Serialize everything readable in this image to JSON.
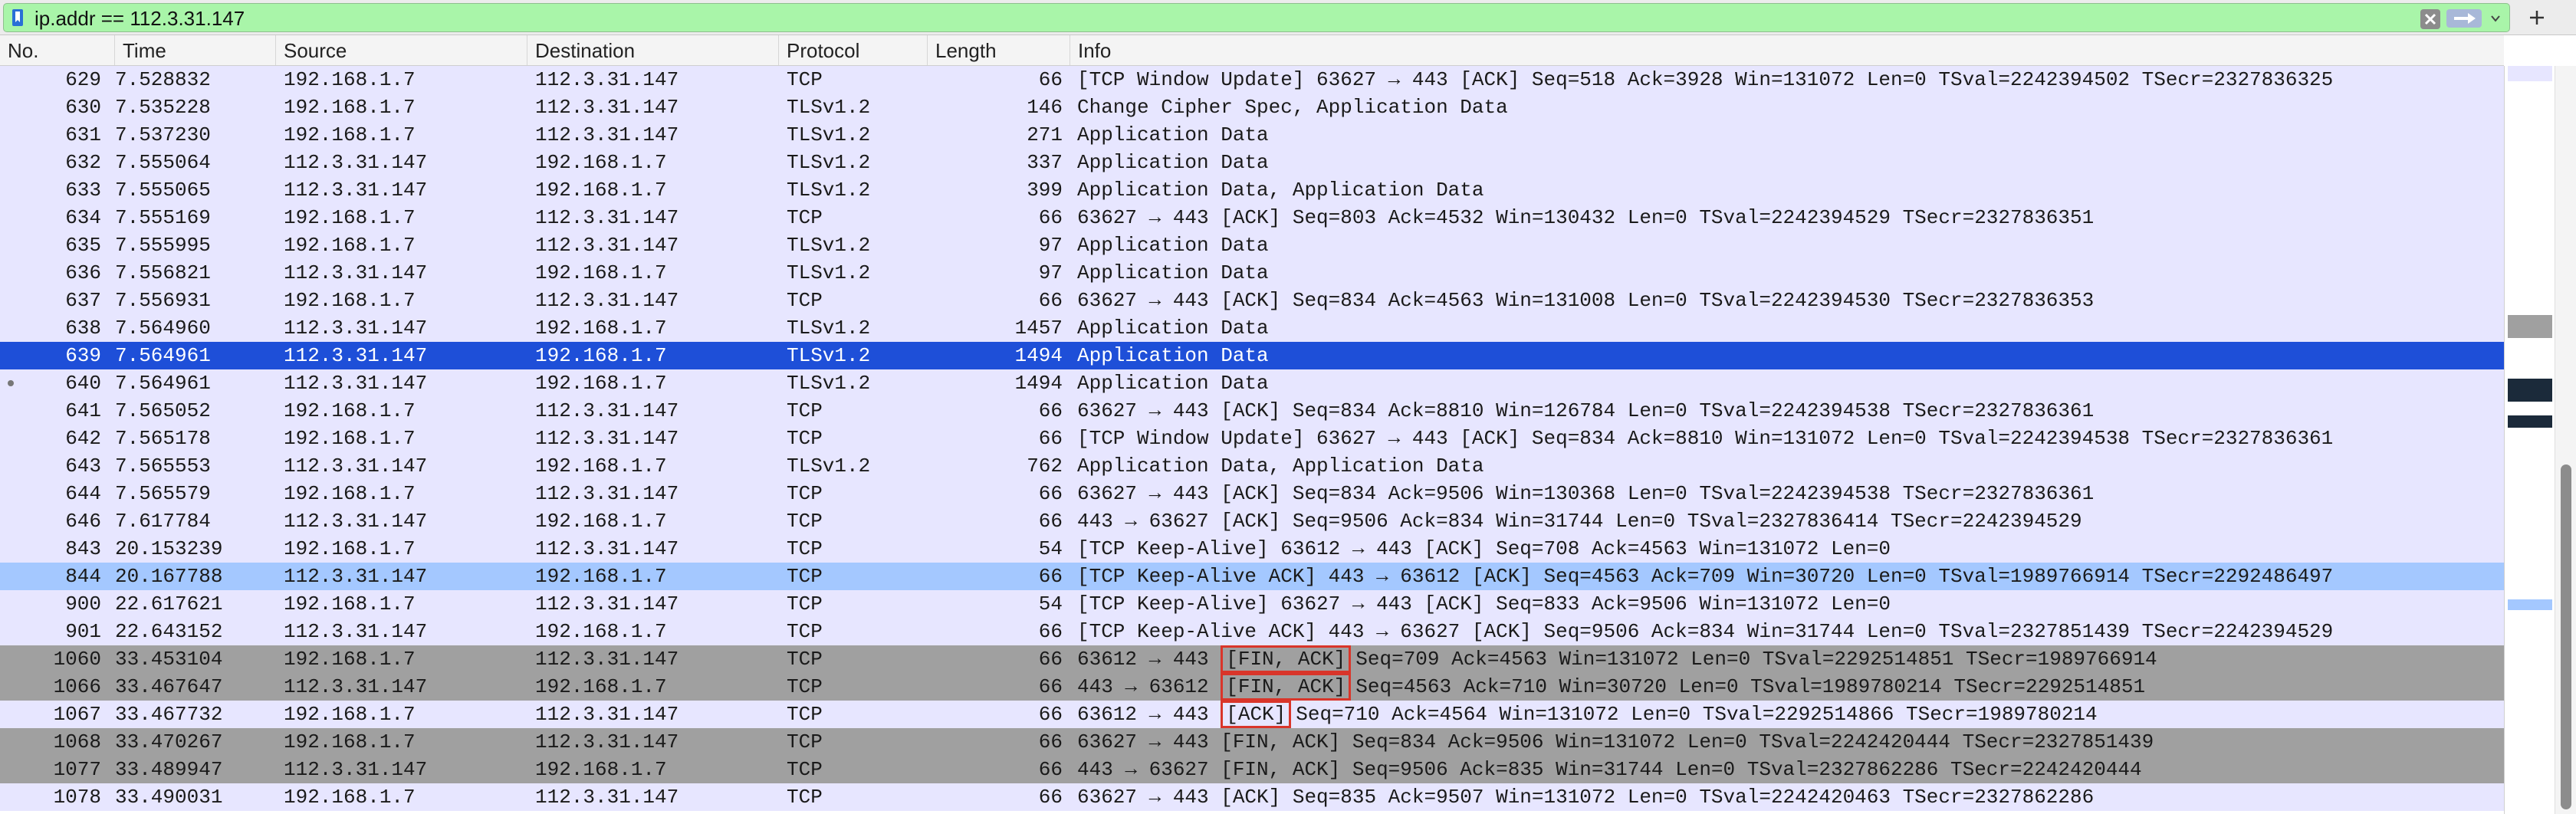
{
  "filter": {
    "value": "ip.addr == 112.3.31.147"
  },
  "columns": {
    "no": "No.",
    "time": "Time",
    "source": "Source",
    "destination": "Destination",
    "protocol": "Protocol",
    "length": "Length",
    "info": "Info"
  },
  "colors": {
    "filter_valid": "#a9f5a9",
    "row_default": "#e7e6ff",
    "row_selected": "#1e4fd8",
    "row_related": "#a4c8ff",
    "row_fin": "#a0a0a0",
    "highlight_box": "#d9352a"
  },
  "icons": {
    "bookmark": "bookmark-icon",
    "clear": "clear-icon",
    "apply": "apply-arrow-icon",
    "dropdown": "chevron-down-icon",
    "add": "plus-icon"
  },
  "packets": [
    {
      "no": "629",
      "time": "7.528832",
      "src": "192.168.1.7",
      "dst": "112.3.31.147",
      "proto": "TCP",
      "len": "66",
      "flag": "",
      "info": "[TCP Window Update] 63627 → 443 [ACK] Seq=518 Ack=3928 Win=131072 Len=0 TSval=2242394502 TSecr=2327836325",
      "style": "default"
    },
    {
      "no": "630",
      "time": "7.535228",
      "src": "192.168.1.7",
      "dst": "112.3.31.147",
      "proto": "TLSv1.2",
      "len": "146",
      "flag": "",
      "info": "Change Cipher Spec, Application Data",
      "style": "default"
    },
    {
      "no": "631",
      "time": "7.537230",
      "src": "192.168.1.7",
      "dst": "112.3.31.147",
      "proto": "TLSv1.2",
      "len": "271",
      "flag": "",
      "info": "Application Data",
      "style": "default"
    },
    {
      "no": "632",
      "time": "7.555064",
      "src": "112.3.31.147",
      "dst": "192.168.1.7",
      "proto": "TLSv1.2",
      "len": "337",
      "flag": "",
      "info": "Application Data",
      "style": "default"
    },
    {
      "no": "633",
      "time": "7.555065",
      "src": "112.3.31.147",
      "dst": "192.168.1.7",
      "proto": "TLSv1.2",
      "len": "399",
      "flag": "",
      "info": "Application Data, Application Data",
      "style": "default"
    },
    {
      "no": "634",
      "time": "7.555169",
      "src": "192.168.1.7",
      "dst": "112.3.31.147",
      "proto": "TCP",
      "len": "66",
      "flag": "",
      "info": "63627 → 443 [ACK] Seq=803 Ack=4532 Win=130432 Len=0 TSval=2242394529 TSecr=2327836351",
      "style": "default"
    },
    {
      "no": "635",
      "time": "7.555995",
      "src": "192.168.1.7",
      "dst": "112.3.31.147",
      "proto": "TLSv1.2",
      "len": "97",
      "flag": "",
      "info": "Application Data",
      "style": "default"
    },
    {
      "no": "636",
      "time": "7.556821",
      "src": "112.3.31.147",
      "dst": "192.168.1.7",
      "proto": "TLSv1.2",
      "len": "97",
      "flag": "",
      "info": "Application Data",
      "style": "default"
    },
    {
      "no": "637",
      "time": "7.556931",
      "src": "192.168.1.7",
      "dst": "112.3.31.147",
      "proto": "TCP",
      "len": "66",
      "flag": "",
      "info": "63627 → 443 [ACK] Seq=834 Ack=4563 Win=131008 Len=0 TSval=2242394530 TSecr=2327836353",
      "style": "default"
    },
    {
      "no": "638",
      "time": "7.564960",
      "src": "112.3.31.147",
      "dst": "192.168.1.7",
      "proto": "TLSv1.2",
      "len": "1457",
      "flag": "",
      "info": "Application Data",
      "style": "default"
    },
    {
      "no": "639",
      "time": "7.564961",
      "src": "112.3.31.147",
      "dst": "192.168.1.7",
      "proto": "TLSv1.2",
      "len": "1494",
      "flag": "",
      "info": "Application Data",
      "style": "selected"
    },
    {
      "no": "640",
      "time": "7.564961",
      "src": "112.3.31.147",
      "dst": "192.168.1.7",
      "proto": "TLSv1.2",
      "len": "1494",
      "flag": "",
      "info": "Application Data",
      "style": "default"
    },
    {
      "no": "641",
      "time": "7.565052",
      "src": "192.168.1.7",
      "dst": "112.3.31.147",
      "proto": "TCP",
      "len": "66",
      "flag": "",
      "info": "63627 → 443 [ACK] Seq=834 Ack=8810 Win=126784 Len=0 TSval=2242394538 TSecr=2327836361",
      "style": "default"
    },
    {
      "no": "642",
      "time": "7.565178",
      "src": "192.168.1.7",
      "dst": "112.3.31.147",
      "proto": "TCP",
      "len": "66",
      "flag": "",
      "info": "[TCP Window Update] 63627 → 443 [ACK] Seq=834 Ack=8810 Win=131072 Len=0 TSval=2242394538 TSecr=2327836361",
      "style": "default"
    },
    {
      "no": "643",
      "time": "7.565553",
      "src": "112.3.31.147",
      "dst": "192.168.1.7",
      "proto": "TLSv1.2",
      "len": "762",
      "flag": "",
      "info": "Application Data, Application Data",
      "style": "default"
    },
    {
      "no": "644",
      "time": "7.565579",
      "src": "192.168.1.7",
      "dst": "112.3.31.147",
      "proto": "TCP",
      "len": "66",
      "flag": "",
      "info": "63627 → 443 [ACK] Seq=834 Ack=9506 Win=130368 Len=0 TSval=2242394538 TSecr=2327836361",
      "style": "default"
    },
    {
      "no": "646",
      "time": "7.617784",
      "src": "112.3.31.147",
      "dst": "192.168.1.7",
      "proto": "TCP",
      "len": "66",
      "flag": "",
      "info": "443 → 63627 [ACK] Seq=9506 Ack=834 Win=31744 Len=0 TSval=2327836414 TSecr=2242394529",
      "style": "default"
    },
    {
      "no": "843",
      "time": "20.153239",
      "src": "192.168.1.7",
      "dst": "112.3.31.147",
      "proto": "TCP",
      "len": "54",
      "flag": "",
      "info": "[TCP Keep-Alive] 63612 → 443 [ACK] Seq=708 Ack=4563 Win=131072 Len=0",
      "style": "default"
    },
    {
      "no": "844",
      "time": "20.167788",
      "src": "112.3.31.147",
      "dst": "192.168.1.7",
      "proto": "TCP",
      "len": "66",
      "flag": "",
      "info": "[TCP Keep-Alive ACK] 443 → 63612 [ACK] Seq=4563 Ack=709 Win=30720 Len=0 TSval=1989766914 TSecr=2292486497",
      "style": "related"
    },
    {
      "no": "900",
      "time": "22.617621",
      "src": "192.168.1.7",
      "dst": "112.3.31.147",
      "proto": "TCP",
      "len": "54",
      "flag": "",
      "info": "[TCP Keep-Alive] 63627 → 443 [ACK] Seq=833 Ack=9506 Win=131072 Len=0",
      "style": "default"
    },
    {
      "no": "901",
      "time": "22.643152",
      "src": "112.3.31.147",
      "dst": "192.168.1.7",
      "proto": "TCP",
      "len": "66",
      "flag": "",
      "info": "[TCP Keep-Alive ACK] 443 → 63627 [ACK] Seq=9506 Ack=834 Win=31744 Len=0 TSval=2327851439 TSecr=2242394529",
      "style": "default"
    },
    {
      "no": "1060",
      "time": "33.453104",
      "src": "192.168.1.7",
      "dst": "112.3.31.147",
      "proto": "TCP",
      "len": "66",
      "prefix": "63612 → 443",
      "flag": "[FIN, ACK]",
      "info": "Seq=709 Ack=4563 Win=131072 Len=0 TSval=2292514851 TSecr=1989766914",
      "style": "fin"
    },
    {
      "no": "1066",
      "time": "33.467647",
      "src": "112.3.31.147",
      "dst": "192.168.1.7",
      "proto": "TCP",
      "len": "66",
      "prefix": "443 → 63612",
      "flag": "[FIN, ACK]",
      "info": "Seq=4563 Ack=710 Win=30720 Len=0 TSval=1989780214 TSecr=2292514851",
      "style": "fin"
    },
    {
      "no": "1067",
      "time": "33.467732",
      "src": "192.168.1.7",
      "dst": "112.3.31.147",
      "proto": "TCP",
      "len": "66",
      "prefix": "63612 → 443",
      "flag": "[ACK]",
      "info": "Seq=710 Ack=4564 Win=131072 Len=0 TSval=2292514866 TSecr=1989780214",
      "style": "default"
    },
    {
      "no": "1068",
      "time": "33.470267",
      "src": "192.168.1.7",
      "dst": "112.3.31.147",
      "proto": "TCP",
      "len": "66",
      "flag": "",
      "info": "63627 → 443 [FIN, ACK] Seq=834 Ack=9506 Win=131072 Len=0 TSval=2242420444 TSecr=2327851439",
      "style": "fin"
    },
    {
      "no": "1077",
      "time": "33.489947",
      "src": "112.3.31.147",
      "dst": "192.168.1.7",
      "proto": "TCP",
      "len": "66",
      "flag": "",
      "info": "443 → 63627 [FIN, ACK] Seq=9506 Ack=835 Win=31744 Len=0 TSval=2327862286 TSecr=2242420444",
      "style": "fin"
    },
    {
      "no": "1078",
      "time": "33.490031",
      "src": "192.168.1.7",
      "dst": "112.3.31.147",
      "proto": "TCP",
      "len": "66",
      "flag": "",
      "info": "63627 → 443 [ACK] Seq=835 Ack=9507 Win=131072 Len=0 TSval=2242420463 TSecr=2327862286",
      "style": "default"
    }
  ]
}
